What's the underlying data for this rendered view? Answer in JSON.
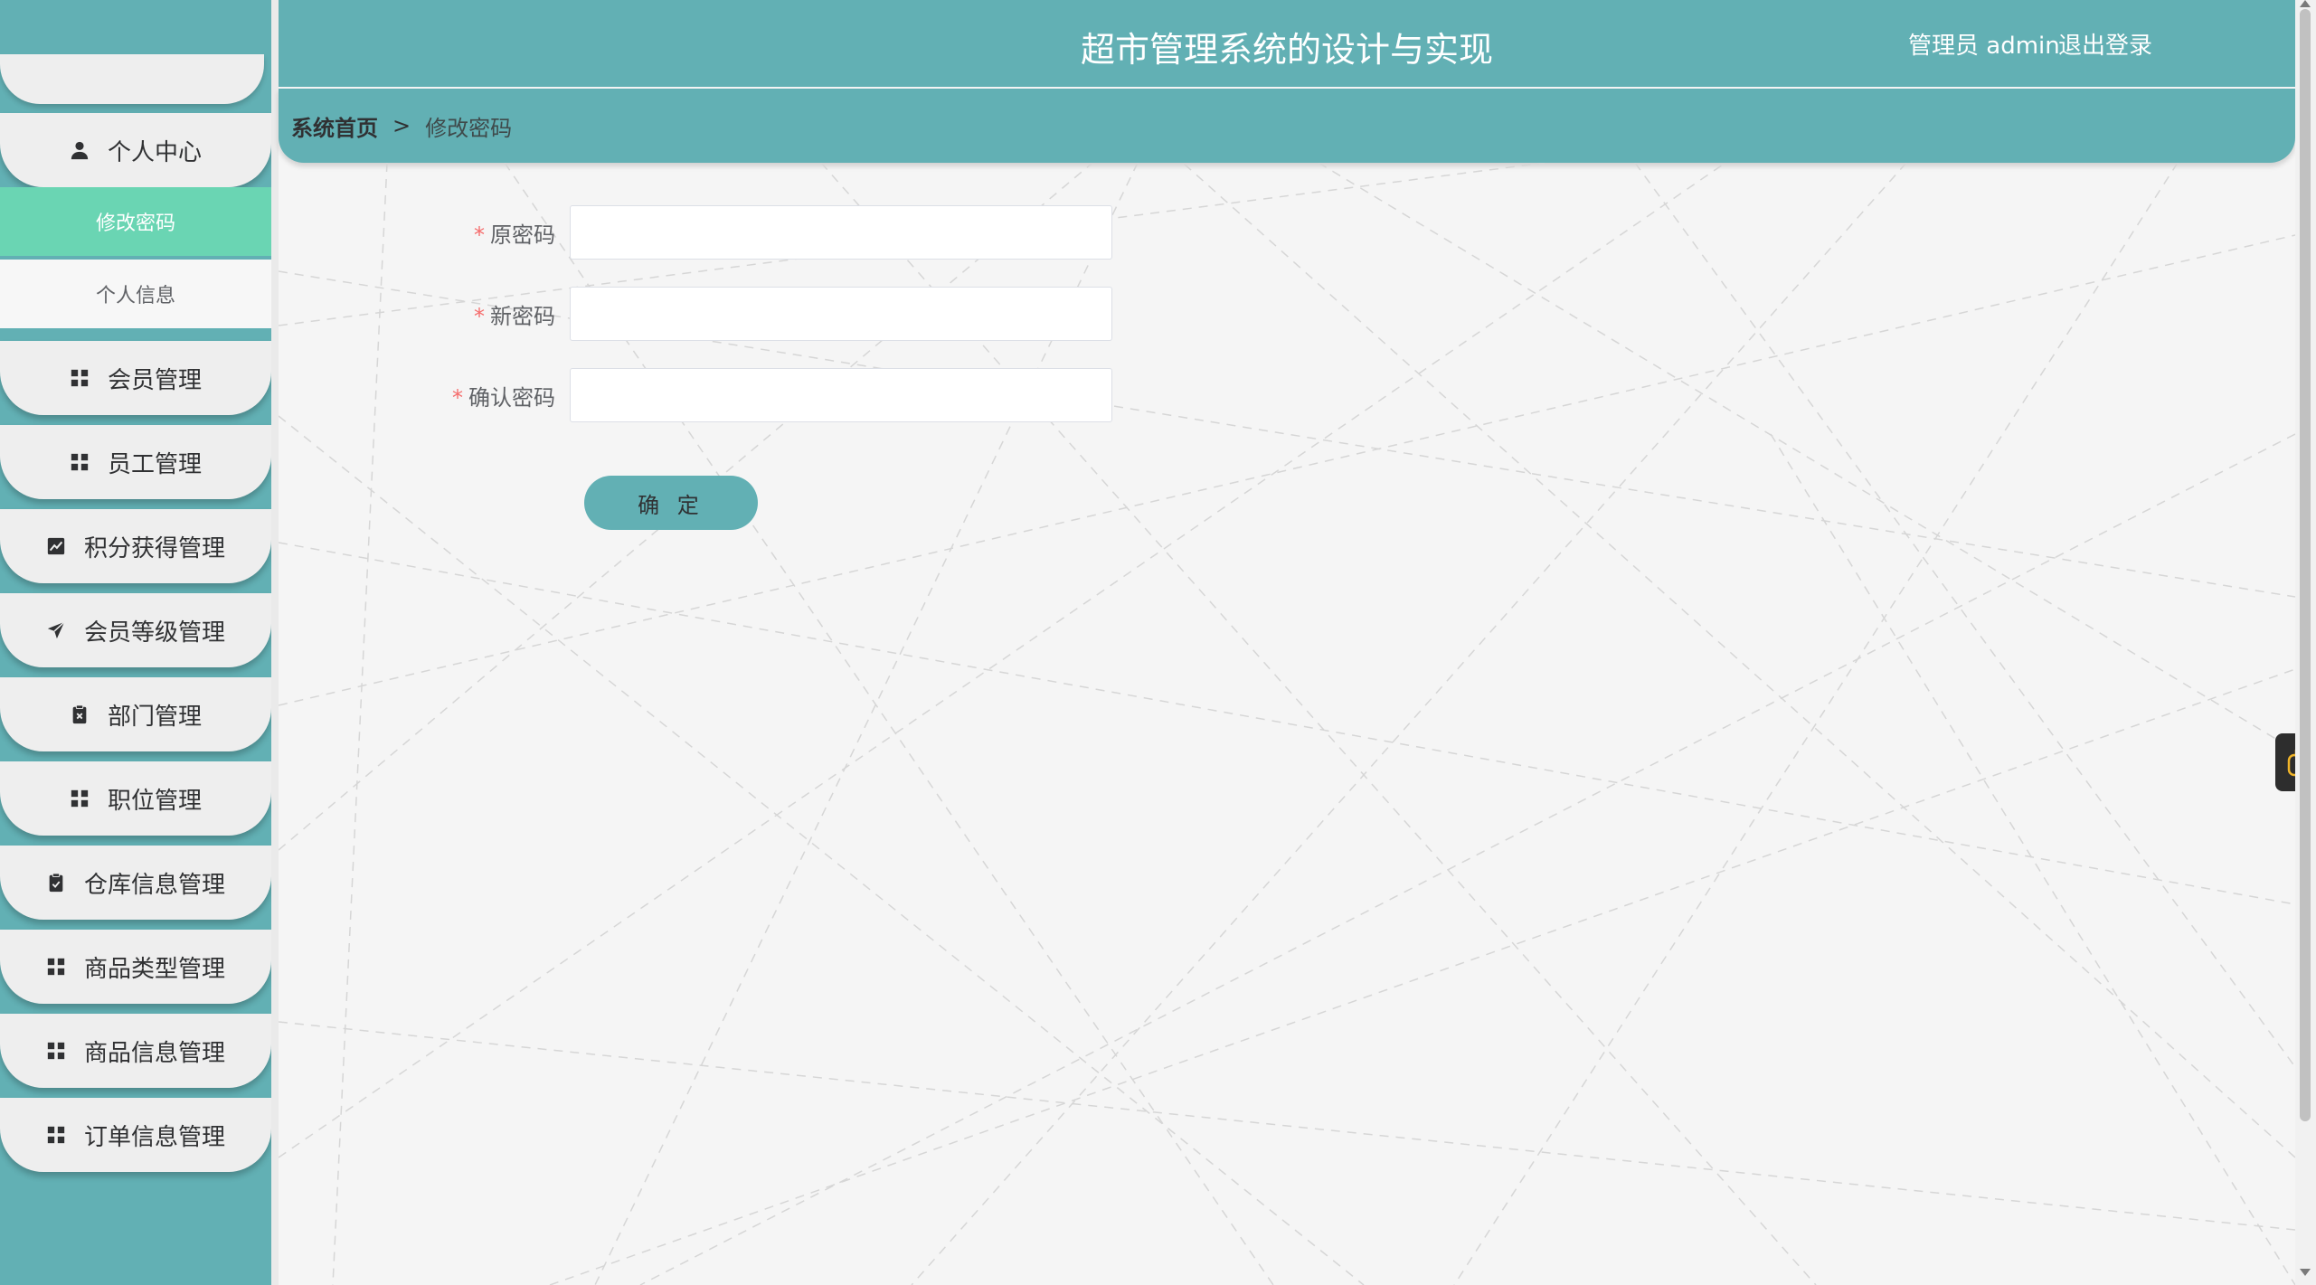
{
  "header": {
    "title": "超市管理系统的设计与实现",
    "user": "管理员 admin",
    "logout": "退出登录"
  },
  "breadcrumb": {
    "home": "系统首页",
    "separator": ">",
    "current": "修改密码"
  },
  "sidebar": {
    "items": [
      {
        "label": "个人中心",
        "icon": "user-icon"
      },
      {
        "label": "会员管理",
        "icon": "grid-icon"
      },
      {
        "label": "员工管理",
        "icon": "grid-icon"
      },
      {
        "label": "积分获得管理",
        "icon": "chart-icon"
      },
      {
        "label": "会员等级管理",
        "icon": "send-icon"
      },
      {
        "label": "部门管理",
        "icon": "clipboard-x-icon"
      },
      {
        "label": "职位管理",
        "icon": "grid-icon"
      },
      {
        "label": "仓库信息管理",
        "icon": "clipboard-check-icon"
      },
      {
        "label": "商品类型管理",
        "icon": "grid-icon"
      },
      {
        "label": "商品信息管理",
        "icon": "grid-icon"
      },
      {
        "label": "订单信息管理",
        "icon": "grid-icon"
      }
    ],
    "submenu": [
      {
        "label": "修改密码",
        "active": true
      },
      {
        "label": "个人信息",
        "active": false
      }
    ]
  },
  "form": {
    "required_mark": "*",
    "fields": [
      {
        "label": "原密码",
        "value": "",
        "placeholder": ""
      },
      {
        "label": "新密码",
        "value": "",
        "placeholder": ""
      },
      {
        "label": "确认密码",
        "value": "",
        "placeholder": ""
      }
    ],
    "submit": "确 定"
  },
  "colors": {
    "primary": "#62b0b4",
    "active_menu": "#6ad5b3",
    "required": "#f56c6c",
    "widget_icon": "#f0b429"
  }
}
